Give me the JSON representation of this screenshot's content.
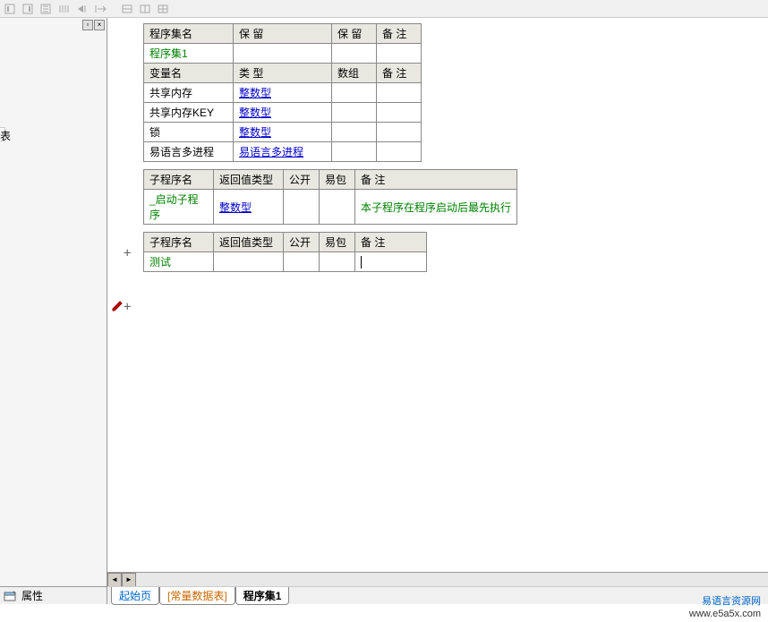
{
  "toolbar": {
    "icons": [
      "align-left",
      "align-right",
      "align-justify",
      "bars",
      "prev",
      "next",
      "sep",
      "tool1",
      "tool2",
      "tool3"
    ]
  },
  "leftPanel": {
    "stubChar": "表",
    "propLabel": "属性"
  },
  "table1": {
    "headers": {
      "name": "程序集名",
      "keep1": "保 留",
      "keep2": "保 留",
      "note": "备 注"
    },
    "row": {
      "name": "程序集1",
      "c1": "",
      "c2": "",
      "c3": ""
    }
  },
  "table2": {
    "headers": {
      "name": "变量名",
      "type": "类 型",
      "arr": "数组",
      "note": "备 注"
    },
    "rows": [
      {
        "name": "共享内存",
        "type": "整数型",
        "arr": "",
        "note": ""
      },
      {
        "name": "共享内存KEY",
        "type": "整数型",
        "arr": "",
        "note": ""
      },
      {
        "name": "锁",
        "type": "整数型",
        "arr": "",
        "note": ""
      },
      {
        "name": "易语言多进程",
        "type": "易语言多进程",
        "arr": "",
        "note": ""
      }
    ]
  },
  "table3": {
    "headers": {
      "name": "子程序名",
      "ret": "返回值类型",
      "pub": "公开",
      "pkg": "易包",
      "note": "备 注"
    },
    "row": {
      "name": "_启动子程序",
      "ret": "整数型",
      "pub": "",
      "pkg": "",
      "note": "本子程序在程序启动后最先执行"
    }
  },
  "table4": {
    "headers": {
      "name": "子程序名",
      "ret": "返回值类型",
      "pub": "公开",
      "pkg": "易包",
      "note": "备 注"
    },
    "row": {
      "name": "测试",
      "ret": "",
      "pub": "",
      "pkg": "",
      "note": ""
    }
  },
  "tabs": {
    "start": "起始页",
    "data": "[常量数据表]",
    "active": "程序集1"
  },
  "watermark": {
    "line1": "易语言资源网",
    "line2": "www.e5a5x.com"
  },
  "markers": {
    "plus": "+"
  }
}
